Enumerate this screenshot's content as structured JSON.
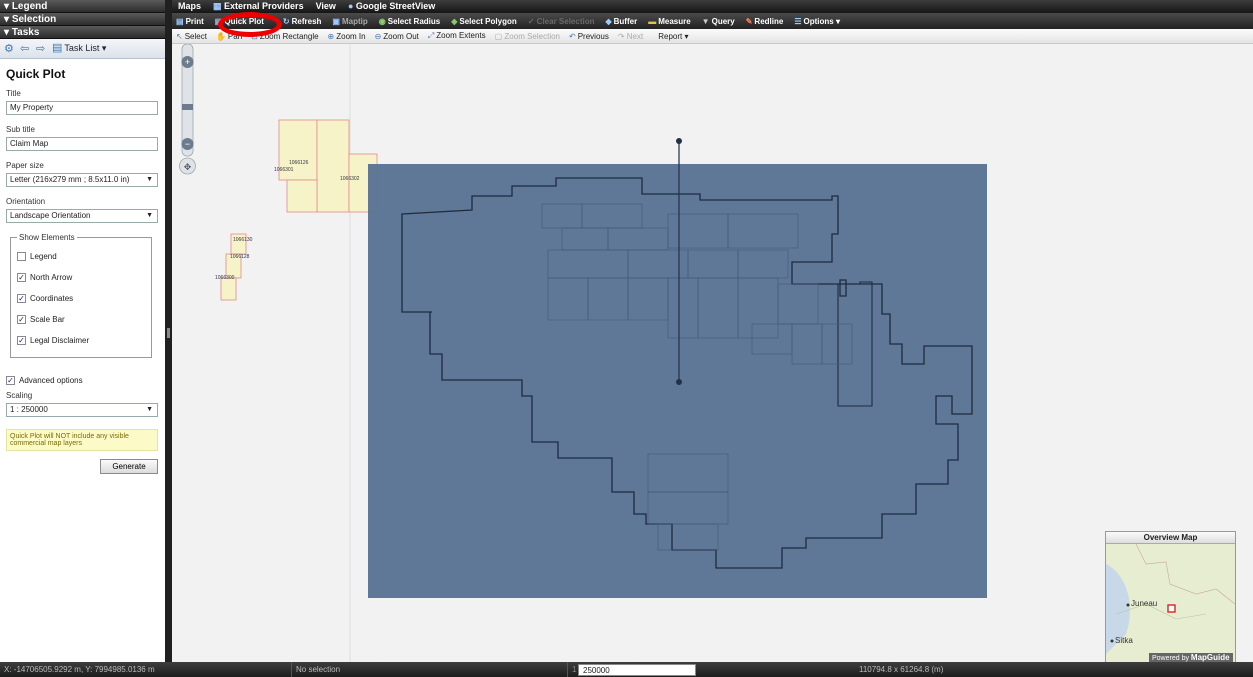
{
  "left_panel": {
    "accordion": [
      "Legend",
      "Selection",
      "Tasks"
    ],
    "task_list_label": "Task List",
    "quick_plot": {
      "heading": "Quick Plot",
      "title_label": "Title",
      "title_value": "My Property",
      "subtitle_label": "Sub title",
      "subtitle_value": "Claim Map",
      "paper_size_label": "Paper size",
      "paper_size_value": "Letter (216x279 mm ; 8.5x11.0 in)",
      "orientation_label": "Orientation",
      "orientation_value": "Landscape Orientation",
      "show_elements_label": "Show Elements",
      "elements": [
        {
          "label": "Legend",
          "checked": false
        },
        {
          "label": "North Arrow",
          "checked": true
        },
        {
          "label": "Coordinates",
          "checked": true
        },
        {
          "label": "Scale Bar",
          "checked": true
        },
        {
          "label": "Legal Disclaimer",
          "checked": true
        }
      ],
      "advanced_label": "Advanced options",
      "scaling_label": "Scaling",
      "scaling_value": "1 : 250000",
      "note": "Quick Plot will NOT include any visible commercial map layers",
      "generate_label": "Generate"
    }
  },
  "menubar": {
    "items": [
      "Maps",
      "External Providers",
      "View",
      "Google StreetView"
    ]
  },
  "toolbar1": {
    "print": "Print",
    "quick_plot": "Quick Plot",
    "refresh": "Refresh",
    "maptip": "Maptip",
    "select_radius": "Select Radius",
    "select_polygon": "Select Polygon",
    "clear_selection": "Clear Selection",
    "buffer": "Buffer",
    "measure": "Measure",
    "query": "Query",
    "redline": "Redline",
    "options": "Options"
  },
  "toolbar2": {
    "select": "Select",
    "pan": "Pan",
    "zoom_rectangle": "Zoom Rectangle",
    "zoom_in": "Zoom In",
    "zoom_out": "Zoom Out",
    "zoom_extents": "Zoom Extents",
    "zoom_selection": "Zoom Selection",
    "previous": "Previous",
    "next": "Next",
    "report": "Report"
  },
  "map": {
    "claim_labels": [
      "1066126",
      "1066301",
      "1066302",
      "1066130",
      "1066128",
      "1066300"
    ],
    "plot_area_color": "#5a7294",
    "claim_fill": "#f6f3c8",
    "claim_border": "#e38a8a"
  },
  "overview": {
    "title": "Overview Map",
    "places": [
      "Juneau",
      "Sitka"
    ],
    "powered_by": "Powered by",
    "brand": "MapGuide"
  },
  "status": {
    "coords": "X: -14706505.9292 m, Y: 7994985.0136 m",
    "selection": "No selection",
    "scale_prefix": "1 :",
    "scale": "250000",
    "extent": "110794.8 x 61264.8 (m)"
  }
}
